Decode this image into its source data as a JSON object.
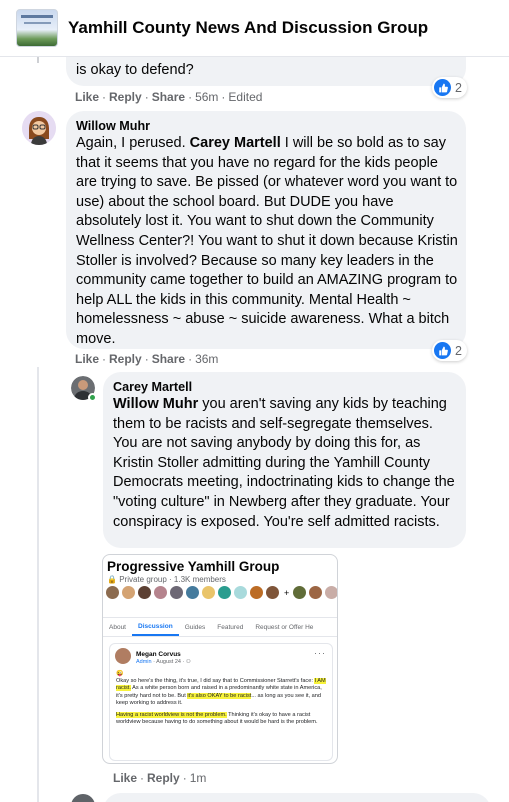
{
  "header": {
    "group_title": "Yamhill County News And Discussion Group"
  },
  "comments": [
    {
      "text_tail": "is okay to defend?",
      "actions": {
        "like": "Like",
        "reply": "Reply",
        "share": "Share",
        "time": "56m",
        "edited": "Edited"
      },
      "reaction_count": "2"
    },
    {
      "author": "Willow Muhr",
      "text_parts": {
        "p1": "Again, I perused. ",
        "mention": "Carey Martell",
        "p2": " I will be so bold as to say that it seems that you have no regard for the kids people are trying to save. Be pissed (or whatever word you want to use) about the school board. But DUDE you have absolutely lost it. You want to shut down the Community Wellness Center?! You want to shut it down because Kristin Stoller is involved? Because so many key leaders in the community came together to build an AMAZING program to help ALL the kids in this community. Mental Health ~ homelessness ~ abuse ~ suicide awareness. What a bitch move."
      },
      "actions": {
        "like": "Like",
        "reply": "Reply",
        "share": "Share",
        "time": "36m"
      },
      "reaction_count": "2"
    },
    {
      "author": "Carey Martell",
      "text_parts": {
        "mention": "Willow Muhr",
        "p1": " you aren't saving any kids by teaching them to be racists and self-segregate themselves. You are not saving anybody by doing this for, as Kristin Stoller admitting during the Yamhill County Democrats meeting, indoctrinating kids to change the \"voting culture\" in Newberg after they graduate. Your conspiracy is exposed. You're self admitted racists."
      },
      "actions": {
        "like": "Like",
        "reply": "Reply",
        "time": "1m"
      }
    }
  ],
  "embedded_screenshot": {
    "group_name": "Progressive Yamhill Group",
    "group_meta": "Private group · 1.3K members",
    "tabs": [
      "About",
      "Discussion",
      "Guides",
      "Featured",
      "Request or Offer He"
    ],
    "post_author": "Megan Corvus",
    "post_role": "Admin",
    "post_date": " · August 24 · ",
    "post_emoji": "😜",
    "post_body": {
      "a": "Okay so here's the thing, it's true, I did say that to Commissioner Starrett's face: ",
      "hl1": "I AM racist.",
      "b": " As a white person born and raised in a predominantly white state in America, it's pretty hard not to be.  But ",
      "hl2": "it's also OKAY to be racist",
      "c": "... as long as you see it, and keep working to address it.",
      "hl3": "Having a racist worldview is not the problem.",
      "d": " Thinking it's okay to have a racist worldview because having to do something about it would be hard is the problem."
    }
  },
  "colors": {
    "link_blue": "#1877f2",
    "bubble_gray": "#f0f2f5",
    "meta_gray": "#65676b",
    "highlight_yellow": "#f8f33c"
  }
}
